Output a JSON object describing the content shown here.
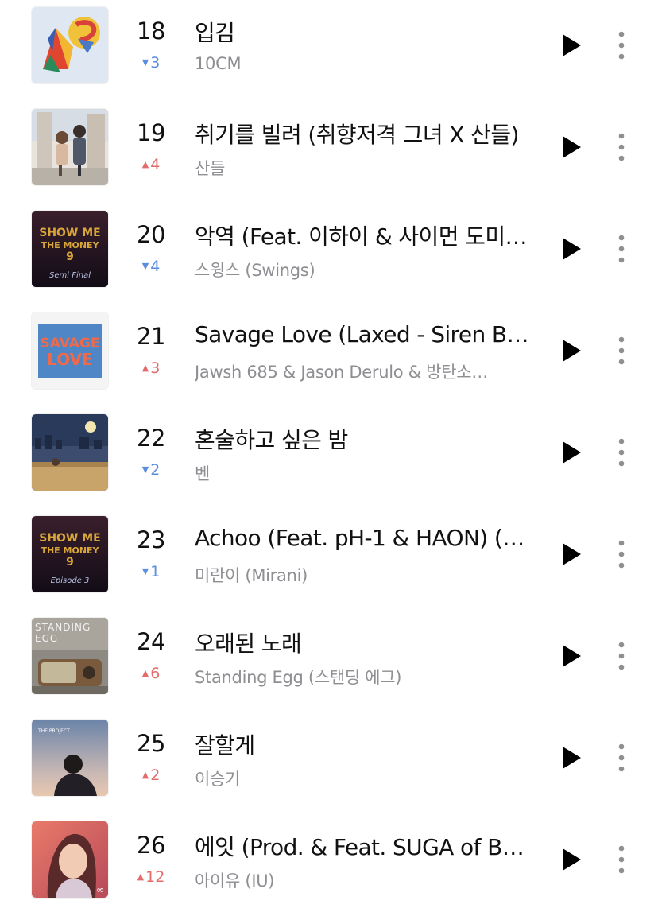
{
  "chart_rows": [
    {
      "rank": "18",
      "direction": "down",
      "change": "3",
      "title": "입김",
      "artist": "10CM",
      "cover": "abstract-colorful-cover"
    },
    {
      "rank": "19",
      "direction": "up",
      "change": "4",
      "title": "취기를 빌려 (취향저격 그녀 X 산들)",
      "artist": "산들",
      "cover": "illustrated-couple-cover"
    },
    {
      "rank": "20",
      "direction": "down",
      "change": "4",
      "title": "악역 (Feat. 이하이 & 사이먼 도미…",
      "artist": "스윙스 (Swings)",
      "cover": "show-me-the-money-cover",
      "cover_text": [
        "SHOW ME",
        "THE MONEY",
        "9",
        "Semi Final"
      ]
    },
    {
      "rank": "21",
      "direction": "up",
      "change": "3",
      "title": "Savage Love (Laxed - Siren B…",
      "artist": "Jawsh 685 & Jason Derulo & 방탄소…",
      "cover": "savage-love-cover",
      "cover_text": [
        "SAVAGE",
        "LOVE"
      ]
    },
    {
      "rank": "22",
      "direction": "down",
      "change": "2",
      "title": "혼술하고 싶은 밤",
      "artist": "벤",
      "cover": "night-city-cover"
    },
    {
      "rank": "23",
      "direction": "down",
      "change": "1",
      "title": "Achoo (Feat. pH-1 & HAON) (…",
      "artist": "미란이 (Mirani)",
      "cover": "show-me-the-money-cover",
      "cover_text": [
        "SHOW ME",
        "THE MONEY",
        "9",
        "Episode 3"
      ]
    },
    {
      "rank": "24",
      "direction": "up",
      "change": "6",
      "title": "오래된 노래",
      "artist": "Standing Egg (스탠딩 에그)",
      "cover": "radio-cover",
      "cover_text": [
        "STANDING",
        "EGG"
      ]
    },
    {
      "rank": "25",
      "direction": "up",
      "change": "2",
      "title": "잘할게",
      "artist": "이승기",
      "cover": "portrait-cover",
      "cover_text": [
        "THE PROJECT"
      ]
    },
    {
      "rank": "26",
      "direction": "up",
      "change": "12",
      "title": "에잇 (Prod. & Feat. SUGA of B…",
      "artist": "아이유 (IU)",
      "cover": "illustrated-girl-cover"
    }
  ],
  "icons": {
    "play": "play-icon",
    "more": "more-vertical-icon",
    "up": "triangle-up-icon",
    "down": "triangle-down-icon"
  },
  "colors": {
    "up": "#e36b6b",
    "down": "#5b8dde",
    "artist": "#8e8e93",
    "text": "#111111"
  }
}
